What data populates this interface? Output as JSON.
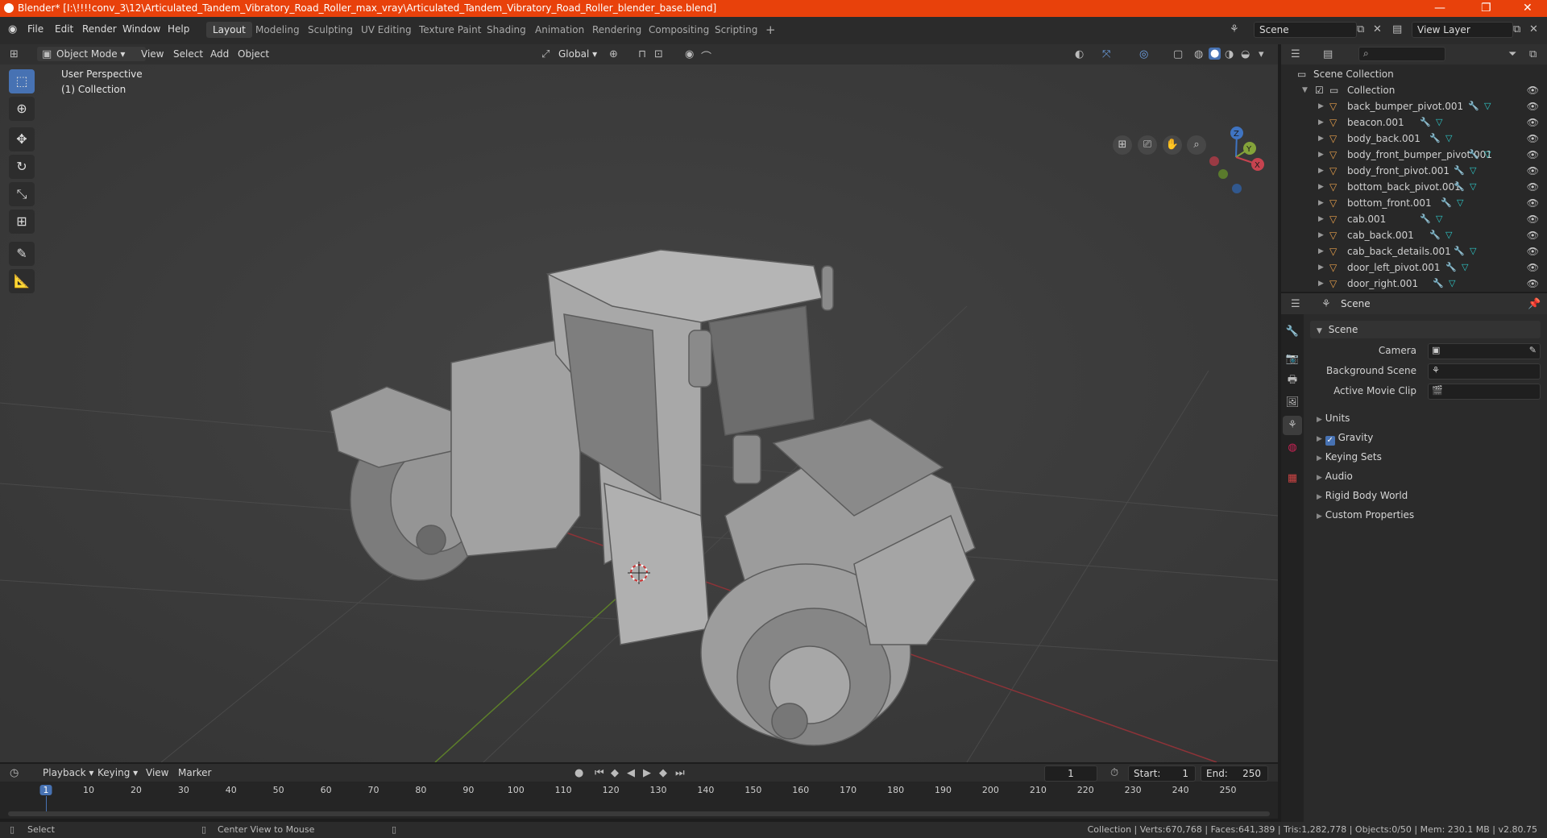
{
  "window": {
    "title": "Blender* [I:\\!!!!conv_3\\12\\Articulated_Tandem_Vibratory_Road_Roller_max_vray\\Articulated_Tandem_Vibratory_Road_Roller_blender_base.blend]",
    "minimize": "—",
    "maximize": "❐",
    "close": "✕"
  },
  "menubar": {
    "items": [
      "File",
      "Edit",
      "Render",
      "Window",
      "Help"
    ],
    "workspaces": [
      "Layout",
      "Modeling",
      "Sculpting",
      "UV Editing",
      "Texture Paint",
      "Shading",
      "Animation",
      "Rendering",
      "Compositing",
      "Scripting"
    ],
    "active_workspace": "Layout",
    "add_tab": "+",
    "scene": "Scene",
    "view_layer": "View Layer"
  },
  "viewport_header": {
    "mode": "Object Mode",
    "menus": [
      "View",
      "Select",
      "Add",
      "Object"
    ],
    "orientation": "Global"
  },
  "viewport": {
    "perspective": "User Perspective",
    "collection": "(1) Collection",
    "gizmo": {
      "x": "X",
      "y": "Y",
      "z": "Z"
    }
  },
  "outliner": {
    "root": "Scene Collection",
    "collection": "Collection",
    "objects": [
      "back_bumper_pivot.001",
      "beacon.001",
      "body_back.001",
      "body_front_bumper_pivot.001",
      "body_front_pivot.001",
      "bottom_back_pivot.001",
      "bottom_front.001",
      "cab.001",
      "cab_back.001",
      "cab_back_details.001",
      "door_left_pivot.001",
      "door_right.001"
    ]
  },
  "properties": {
    "context": "Scene",
    "panel": "Scene",
    "fields": [
      {
        "label": "Camera"
      },
      {
        "label": "Background Scene"
      },
      {
        "label": "Active Movie Clip"
      }
    ],
    "subpanels": [
      "Units",
      "Gravity",
      "Keying Sets",
      "Audio",
      "Rigid Body World",
      "Custom Properties"
    ],
    "gravity_checked": true
  },
  "timeline": {
    "menus": [
      "Playback",
      "Keying",
      "View",
      "Marker"
    ],
    "current_frame": "1",
    "start_label": "Start:",
    "start": "1",
    "end_label": "End:",
    "end": "250",
    "ticks": [
      "1",
      "10",
      "20",
      "30",
      "40",
      "50",
      "60",
      "70",
      "80",
      "90",
      "100",
      "110",
      "120",
      "130",
      "140",
      "150",
      "160",
      "170",
      "180",
      "190",
      "200",
      "210",
      "220",
      "230",
      "240",
      "250"
    ]
  },
  "statusbar": {
    "select": "Select",
    "center": "Center View to Mouse",
    "stats": "Collection | Verts:670,768 | Faces:641,389 | Tris:1,282,778 | Objects:0/50 | Mem: 230.1 MB | v2.80.75"
  },
  "colors": {
    "title_bar": "#e8410b",
    "active_tool": "#4772b3",
    "viewport_bg": "#3c3c3c",
    "axis_x": "#b8343c",
    "axis_y": "#6f9a2e"
  }
}
